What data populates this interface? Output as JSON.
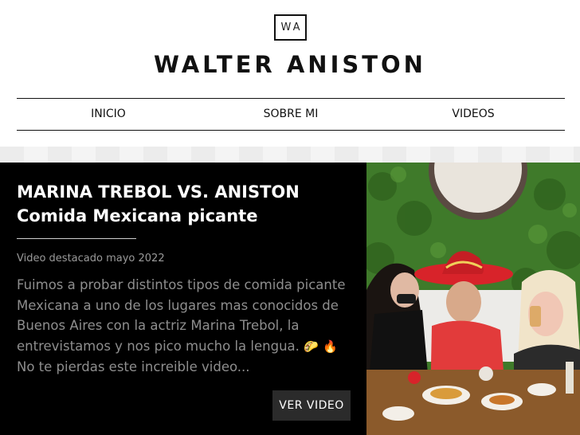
{
  "header": {
    "logo_text": "WA",
    "site_title": "WALTER ANISTON"
  },
  "nav": {
    "items": [
      {
        "label": "INICIO"
      },
      {
        "label": "SOBRE MI"
      },
      {
        "label": "VIDEOS"
      }
    ]
  },
  "featured": {
    "title_line1": "MARINA TREBOL VS. ANISTON",
    "title_line2": "Comida Mexicana picante",
    "date_text": "Video destacado mayo 2022",
    "description": "Fuimos a probar distintos tipos de comida picante Mexicana a uno de los lugares mas conocidos de Buenos Aires con la actriz Marina Trebol, la entrevistamos y nos pico mucho la lengua.",
    "emoji_taco": "🌮",
    "emoji_fire": "🔥",
    "description_end": "No te pierdas este increible video...",
    "button_label": "VER VIDEO"
  },
  "colors": {
    "panel_bg": "#000000",
    "text_gray": "#8e8e8e",
    "button_bg": "#2b2b2b",
    "sombrero_red": "#d8232a",
    "hedge_green": "#3f7a2a"
  }
}
